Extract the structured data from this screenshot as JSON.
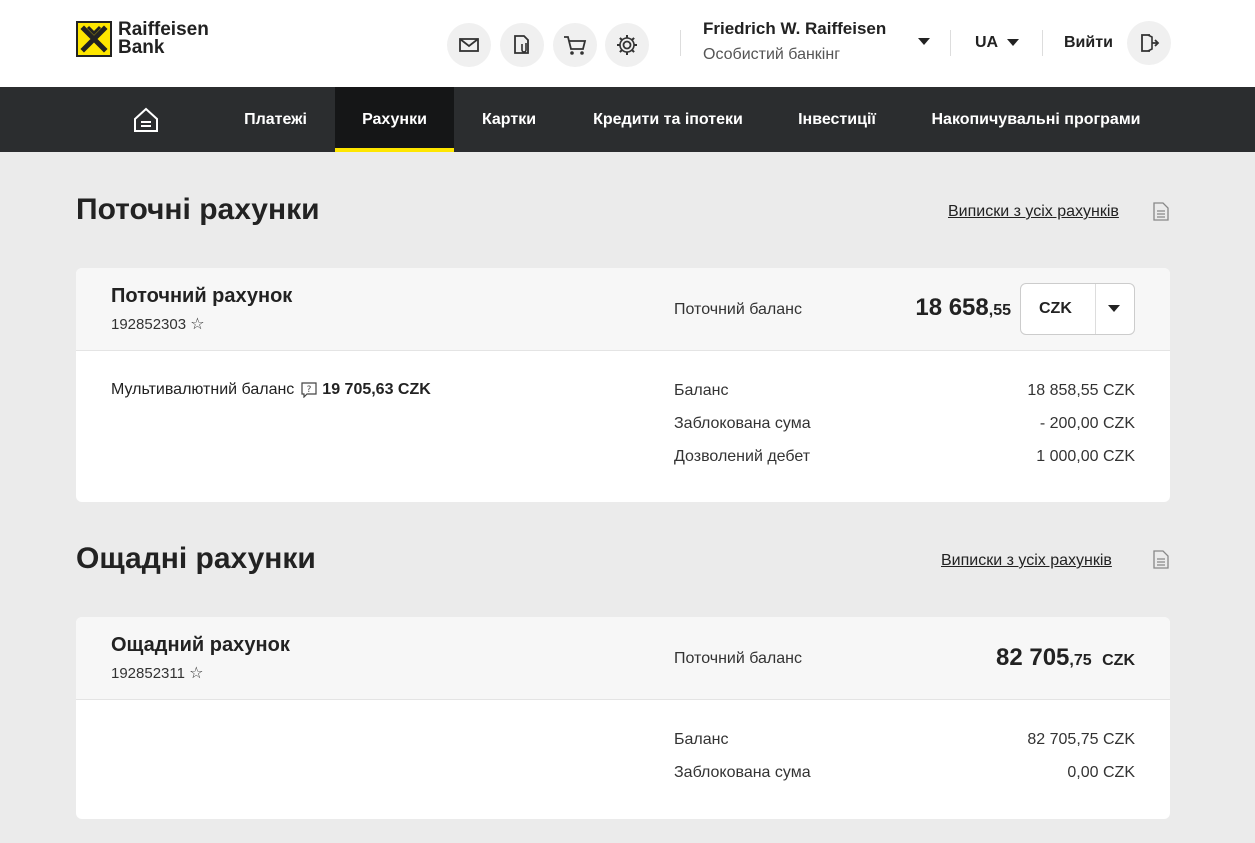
{
  "brand": {
    "name_line1": "Raiffeisen",
    "name_line2": "Bank",
    "accent": "#fee600",
    "dark": "#2b2d2f"
  },
  "header": {
    "icons": [
      "mail-icon",
      "document-clip-icon",
      "cart-icon",
      "gear-icon"
    ],
    "user_name": "Friedrich W. Raiffeisen",
    "user_subtitle": "Особистий банкінг",
    "language": "UA",
    "logout_label": "Вийти"
  },
  "nav": {
    "items": [
      {
        "label": "Платежі"
      },
      {
        "label": "Рахунки",
        "active": true
      },
      {
        "label": "Картки"
      },
      {
        "label": "Кредити та іпотеки"
      },
      {
        "label": "Інвестиції"
      },
      {
        "label": "Накопичувальні програми"
      }
    ]
  },
  "current": {
    "title": "Поточні рахунки",
    "statements_link": "Виписки з усіх рахунків",
    "account": {
      "name": "Поточний рахунок",
      "number": "192852303",
      "star": "☆",
      "balance_label": "Поточний баланс",
      "balance_int": "18 658",
      "balance_dec": ",55",
      "currency": "CZK",
      "multi_label": "Мультивалютний баланс",
      "multi_value": "19 705,63 CZK",
      "rows": [
        {
          "label": "Баланс",
          "value": "18 858,55 CZK"
        },
        {
          "label": "Заблокована сума",
          "value": "- 200,00 CZK"
        },
        {
          "label": "Дозволений дебет",
          "value": "1 000,00 CZK"
        }
      ]
    }
  },
  "savings": {
    "title": "Ощадні рахунки",
    "statements_link": "Виписки з усіх рахунків",
    "account": {
      "name": "Ощадний рахунок",
      "number": "192852311",
      "star": "☆",
      "balance_label": "Поточний баланс",
      "balance_int": "82 705",
      "balance_dec": ",75",
      "currency": "CZK",
      "rows": [
        {
          "label": "Баланс",
          "value": "82 705,75 CZK"
        },
        {
          "label": "Заблокована сума",
          "value": "0,00 CZK"
        }
      ]
    }
  }
}
